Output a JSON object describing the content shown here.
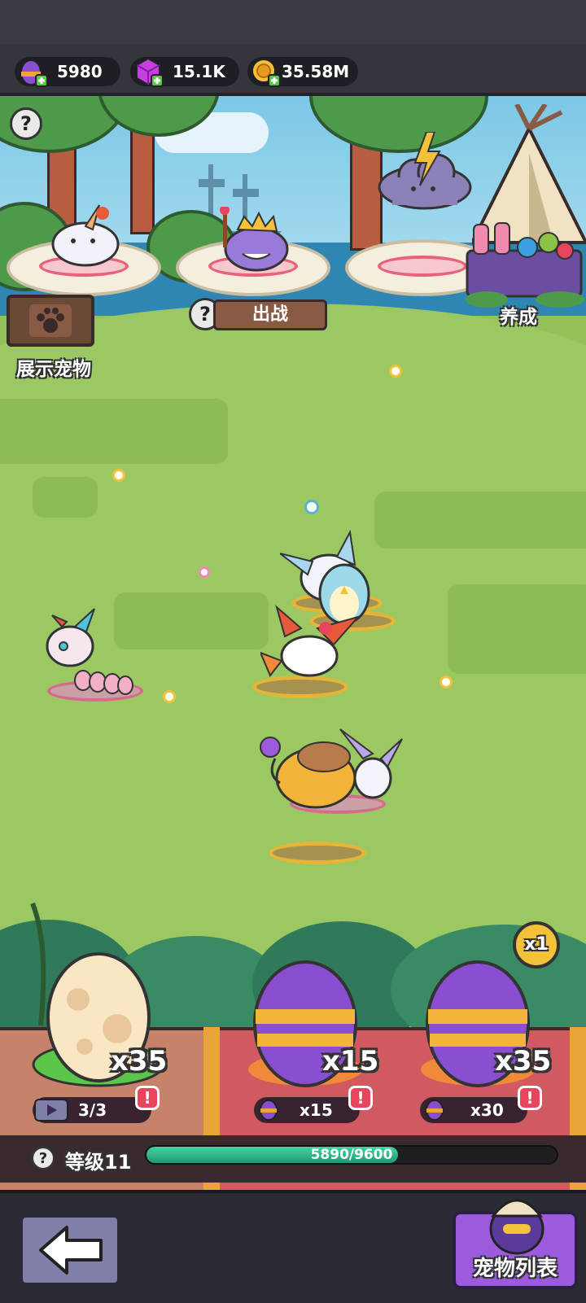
{
  "resources": [
    {
      "name": "purple-egg",
      "value": "5980"
    },
    {
      "name": "gem",
      "value": "15.1K"
    },
    {
      "name": "coin",
      "value": "35.58M"
    }
  ],
  "scene": {
    "show_pets_label": "展示宠物",
    "battle_label": "出战",
    "cultivate_label": "养成"
  },
  "eggs": [
    {
      "type": "plain",
      "count": "x35",
      "ad_progress": "3/3"
    },
    {
      "type": "purple",
      "count": "x15",
      "cost": "x15"
    },
    {
      "type": "purple",
      "count": "x35",
      "cost": "x30"
    }
  ],
  "multiplier": "x1",
  "level": {
    "label": "等级11",
    "xp_text": "5890/9600",
    "progress": 0.614
  },
  "nav": {
    "pet_list_label": "宠物列表"
  },
  "colors": {
    "accent_purple": "#9b5bdc",
    "xp_green": "#37b88a",
    "alert_red": "#e8445c"
  }
}
